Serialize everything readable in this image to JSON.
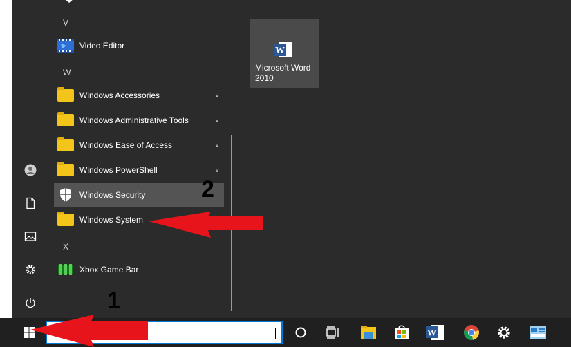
{
  "start_menu": {
    "sections": [
      {
        "letter": "V"
      },
      {
        "letter": "W"
      },
      {
        "letter": "X"
      }
    ],
    "apps": [
      {
        "label": "Video Editor",
        "icon": "video-editor-icon"
      },
      {
        "label": "Windows Accessories",
        "icon": "folder-icon",
        "expandable": true
      },
      {
        "label": "Windows Administrative Tools",
        "icon": "folder-icon",
        "expandable": true
      },
      {
        "label": "Windows Ease of Access",
        "icon": "folder-icon",
        "expandable": true
      },
      {
        "label": "Windows PowerShell",
        "icon": "folder-icon",
        "expandable": true
      },
      {
        "label": "Windows Security",
        "icon": "shield-icon",
        "selected": true
      },
      {
        "label": "Windows System",
        "icon": "folder-icon"
      },
      {
        "label": "Xbox Game Bar",
        "icon": "xbox-game-bar-icon"
      }
    ],
    "rail": [
      "user-icon",
      "documents-icon",
      "pictures-icon",
      "settings-icon",
      "power-icon"
    ],
    "tiles": [
      {
        "label": "Microsoft Word 2010",
        "icon": "word-icon"
      }
    ]
  },
  "taskbar": {
    "search_value": "",
    "icons": [
      "start-icon",
      "cortana-icon",
      "task-view-icon",
      "file-explorer-icon",
      "store-icon",
      "word-icon",
      "chrome-icon",
      "settings-icon",
      "control-panel-icon"
    ]
  },
  "annotations": {
    "marker_1": "1",
    "marker_2": "2",
    "arrow_color": "#e8141b"
  },
  "colors": {
    "menu_bg": "#2b2b2b",
    "taskbar_bg": "#202020",
    "selected_bg": "#545454",
    "folder": "#f3c419",
    "accent": "#0078d7"
  }
}
